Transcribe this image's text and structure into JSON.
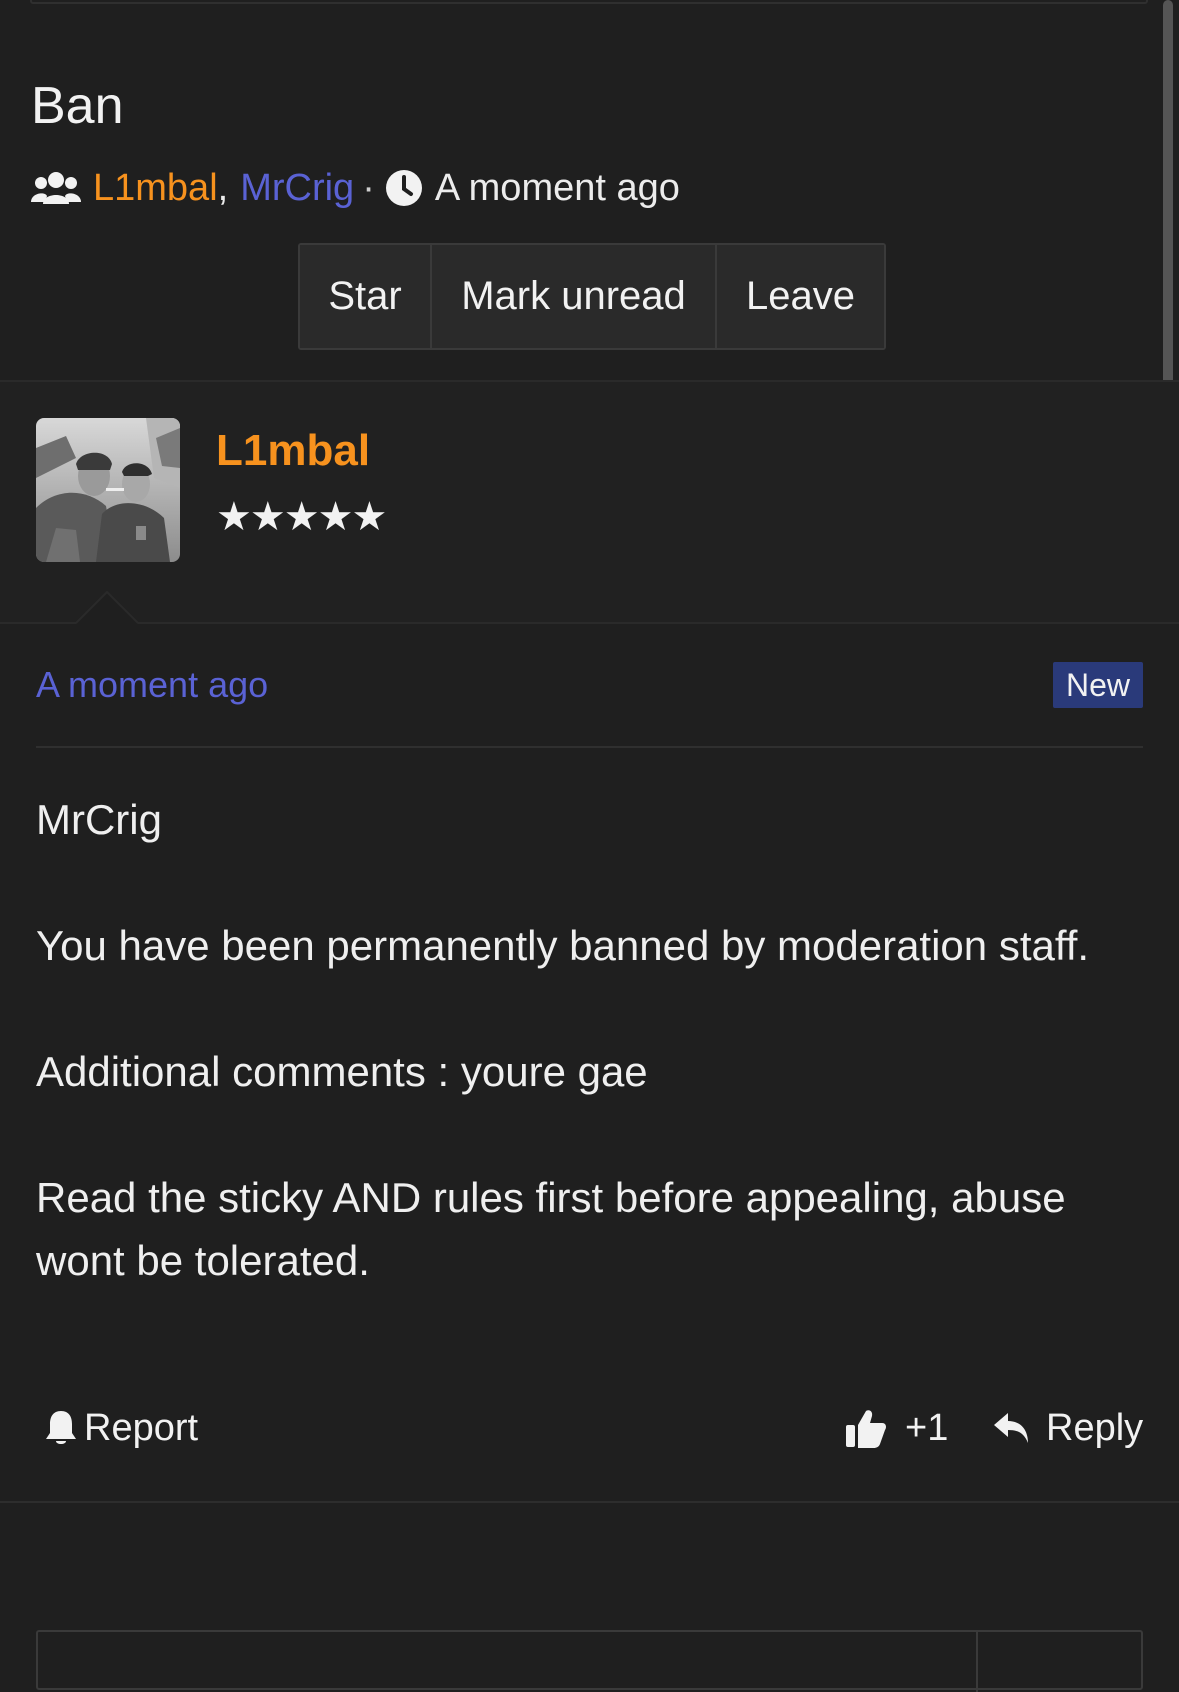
{
  "thread": {
    "title": "Ban",
    "participants": [
      "L1mbal",
      "MrCrig"
    ],
    "comma": ",",
    "dot": "·",
    "time": "A moment ago"
  },
  "buttons": {
    "star": "Star",
    "mark_unread": "Mark unread",
    "leave": "Leave"
  },
  "post": {
    "author": "L1mbal",
    "rank": "★★★★★",
    "time": "A moment ago",
    "badge": "New",
    "body": [
      "MrCrig",
      "You have been permanently banned by moderation staff.",
      "Additional comments : youre gae",
      "Read the sticky AND rules first before appealing, abuse wont be tolerated."
    ],
    "actions": {
      "report": "Report",
      "vote": "+1",
      "reply": "Reply"
    }
  },
  "colors": {
    "background": "#1f1f1f",
    "author_orange": "#f7921e",
    "participant_blue": "#5a62d4",
    "badge_bg": "#2a3a7a"
  },
  "icons": [
    "users-icon",
    "clock-icon",
    "bell-icon",
    "thumbs-up-icon",
    "reply-icon"
  ]
}
